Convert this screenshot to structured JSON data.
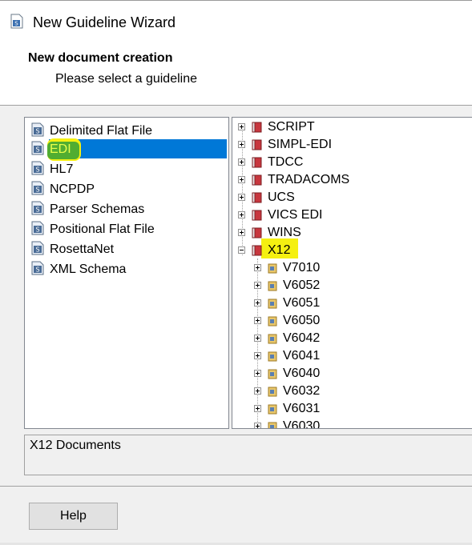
{
  "window": {
    "title": "New Guideline Wizard"
  },
  "header": {
    "title": "New document creation",
    "subtitle": "Please select a guideline"
  },
  "guideline_types": [
    {
      "label": "Delimited Flat File"
    },
    {
      "label": "EDI",
      "selected": true
    },
    {
      "label": "HL7"
    },
    {
      "label": "NCPDP"
    },
    {
      "label": "Parser Schemas"
    },
    {
      "label": "Positional Flat File"
    },
    {
      "label": "RosettaNet"
    },
    {
      "label": "XML Schema"
    }
  ],
  "standards_tree": [
    {
      "label": "SCRIPT"
    },
    {
      "label": "SIMPL-EDI"
    },
    {
      "label": "TDCC"
    },
    {
      "label": "TRADACOMS"
    },
    {
      "label": "UCS"
    },
    {
      "label": "VICS EDI"
    },
    {
      "label": "WINS"
    },
    {
      "label": "X12",
      "expanded": true,
      "children": [
        {
          "label": "V7010"
        },
        {
          "label": "V6052"
        },
        {
          "label": "V6051"
        },
        {
          "label": "V6050"
        },
        {
          "label": "V6042"
        },
        {
          "label": "V6041"
        },
        {
          "label": "V6040"
        },
        {
          "label": "V6032"
        },
        {
          "label": "V6031"
        },
        {
          "label": "V6030"
        }
      ]
    }
  ],
  "description": "X12 Documents",
  "footer": {
    "help_label": "Help"
  },
  "colors": {
    "selection": "#0078d7",
    "highlight_yellow": "#f5f011",
    "highlight_green": "#3fa535",
    "standard_icon": "#c8363e",
    "version_icon": "#e8c66a"
  },
  "icons": {
    "guideline": "document-s-icon",
    "standard": "red-book-icon",
    "version": "folder-doc-icon"
  }
}
